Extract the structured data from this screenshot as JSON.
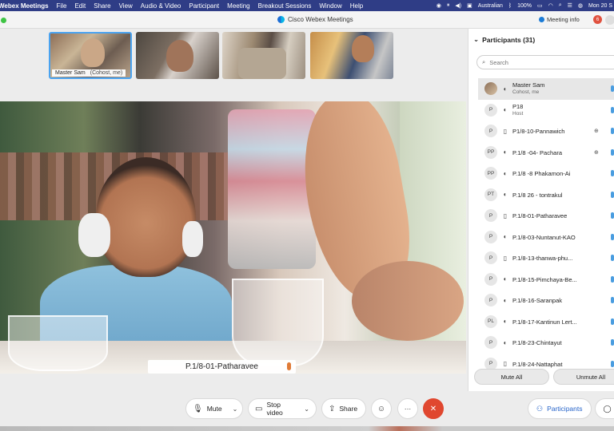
{
  "menubar": {
    "app_name": "Webex Meetings",
    "items": [
      "File",
      "Edit",
      "Share",
      "View",
      "Audio & Video",
      "Participant",
      "Meeting",
      "Breakout Sessions",
      "Window",
      "Help"
    ],
    "input_source": "Australian",
    "battery": "100%",
    "clock": "Mon 20 S"
  },
  "window": {
    "title": "Cisco Webex Meetings",
    "meeting_info": "Meeting info",
    "badge_count": "6"
  },
  "filmstrip": {
    "self_name": "Master Sam",
    "self_role": "(Cohost, me)"
  },
  "main_video": {
    "speaker_name": "P.1/8-01-Patharavee"
  },
  "controls": {
    "mute_label": "Mute",
    "stop_video_label": "Stop video",
    "share_label": "Share",
    "more_label": "···"
  },
  "participants_panel": {
    "title": "Participants (31)",
    "search_placeholder": "Search",
    "participants": [
      {
        "avatar": "",
        "name": "Master Sam",
        "role": "Cohost, me"
      },
      {
        "avatar": "P",
        "name": "P18",
        "role": "Host"
      },
      {
        "avatar": "P",
        "name": "P1/8-10-Pannawich",
        "role": ""
      },
      {
        "avatar": "PP",
        "name": "P.1/8 -04- Pachara",
        "role": ""
      },
      {
        "avatar": "PP",
        "name": "P.1/8 -8 Phakamon-Ai",
        "role": ""
      },
      {
        "avatar": "PT",
        "name": "P.1/8 26 - tontrakul",
        "role": ""
      },
      {
        "avatar": "P",
        "name": "P.1/8-01-Patharavee",
        "role": ""
      },
      {
        "avatar": "P",
        "name": "P.1/8-03-Nuntanut-KAO",
        "role": ""
      },
      {
        "avatar": "P",
        "name": "P.1/8-13-thanwa-phu...",
        "role": ""
      },
      {
        "avatar": "P",
        "name": "P.1/8-15-Pimchaya-Be...",
        "role": ""
      },
      {
        "avatar": "P",
        "name": "P.1/8-16-Saranpak",
        "role": ""
      },
      {
        "avatar": "PL",
        "name": "P.1/8-17-Kantinun Lert...",
        "role": ""
      },
      {
        "avatar": "P",
        "name": "P.1/8-23-Chintayut",
        "role": ""
      },
      {
        "avatar": "P",
        "name": "P.1/8-24-Nattaphat",
        "role": ""
      }
    ],
    "mute_all": "Mute All",
    "unmute_all": "Unmute All"
  },
  "panel_tabs": {
    "participants": "Participants",
    "chat": "Ch"
  }
}
